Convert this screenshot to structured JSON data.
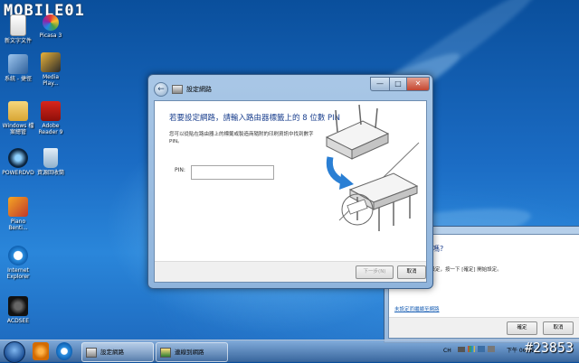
{
  "watermark": {
    "logo": "MOBILE01",
    "id": "#23853"
  },
  "desktop_icons": [
    {
      "label": "新文字文件",
      "icon": "text-file-icon"
    },
    {
      "label": "Picasa 3",
      "icon": "picasa-icon"
    },
    {
      "label": "系統 - 捷徑",
      "icon": "computer-icon"
    },
    {
      "label": "Media Play...",
      "icon": "media-player-icon"
    },
    {
      "label": "Windows 檔案總管",
      "icon": "folder-icon"
    },
    {
      "label": "Adobe Reader 9",
      "icon": "adobe-reader-icon"
    },
    {
      "label": "POWERDVD",
      "icon": "powerdvd-icon"
    },
    {
      "label": "資源回收筒",
      "icon": "recycle-bin-icon"
    },
    {
      "label": "Piano Benti...",
      "icon": "piano-icon"
    },
    {
      "label": "Internet Explorer",
      "icon": "internet-explorer-icon"
    },
    {
      "label": "ACDSEE",
      "icon": "camera-icon"
    }
  ],
  "dialog": {
    "title": "設定網路",
    "heading": "若要設定網路，請輸入路由器標籤上的 8 位數 PIN",
    "description": "您可以從貼在路由器上的標籤或製造商隨附的印刷資訊中找到數字 PIN。",
    "pin_label": "PIN:",
    "pin_value": "",
    "next_button": "下一步(N)",
    "cancel_button": "取消",
    "minimize": "—",
    "maximize": "□",
    "close": "✕"
  },
  "bg_dialog": {
    "question": "路嗎?",
    "instruction": "未設定，按一下 [確定] 開始設定。",
    "link": "未設定而繼續至網路",
    "ok_button": "確定",
    "cancel_button": "取消"
  },
  "taskbar": {
    "tasks": [
      {
        "label": "設定網路",
        "icon": "network-setup-icon"
      },
      {
        "label": "連線到網路",
        "icon": "connect-network-icon"
      }
    ],
    "language": "CH",
    "clock": "下午 06:52"
  }
}
